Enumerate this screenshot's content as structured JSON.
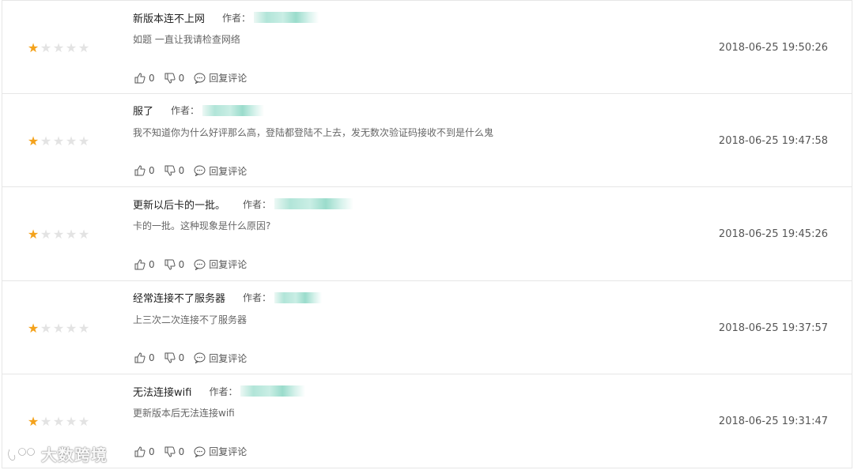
{
  "colors": {
    "star_on": "#f4a21b",
    "star_off": "#e3e3e3",
    "border": "#e6e6e6"
  },
  "labels": {
    "author": "作者：",
    "reply": "回复评论"
  },
  "reviews": [
    {
      "title": "新版本连不上网",
      "content": "如题 一直让我请检查网络",
      "timestamp": "2018-06-25 19:50:26",
      "rating": 1,
      "likes": "0",
      "dislikes": "0"
    },
    {
      "title": "服了",
      "content": "我不知道你为什么好评那么高，登陆都登陆不上去，发无数次验证码接收不到是什么鬼",
      "timestamp": "2018-06-25 19:47:58",
      "rating": 1,
      "likes": "0",
      "dislikes": "0"
    },
    {
      "title": "更新以后卡的一批。",
      "content": "卡的一批。这种现象是什么原因?",
      "timestamp": "2018-06-25 19:45:26",
      "rating": 1,
      "likes": "0",
      "dislikes": "0"
    },
    {
      "title": "经常连接不了服务器",
      "content": "上三次二次连接不了服务器",
      "timestamp": "2018-06-25 19:37:57",
      "rating": 1,
      "likes": "0",
      "dislikes": "0"
    },
    {
      "title": "无法连接wifi",
      "content": "更新版本后无法连接wifi",
      "timestamp": "2018-06-25 19:31:47",
      "rating": 1,
      "likes": "0",
      "dislikes": "0"
    }
  ],
  "watermark": {
    "text": "大数跨境"
  }
}
